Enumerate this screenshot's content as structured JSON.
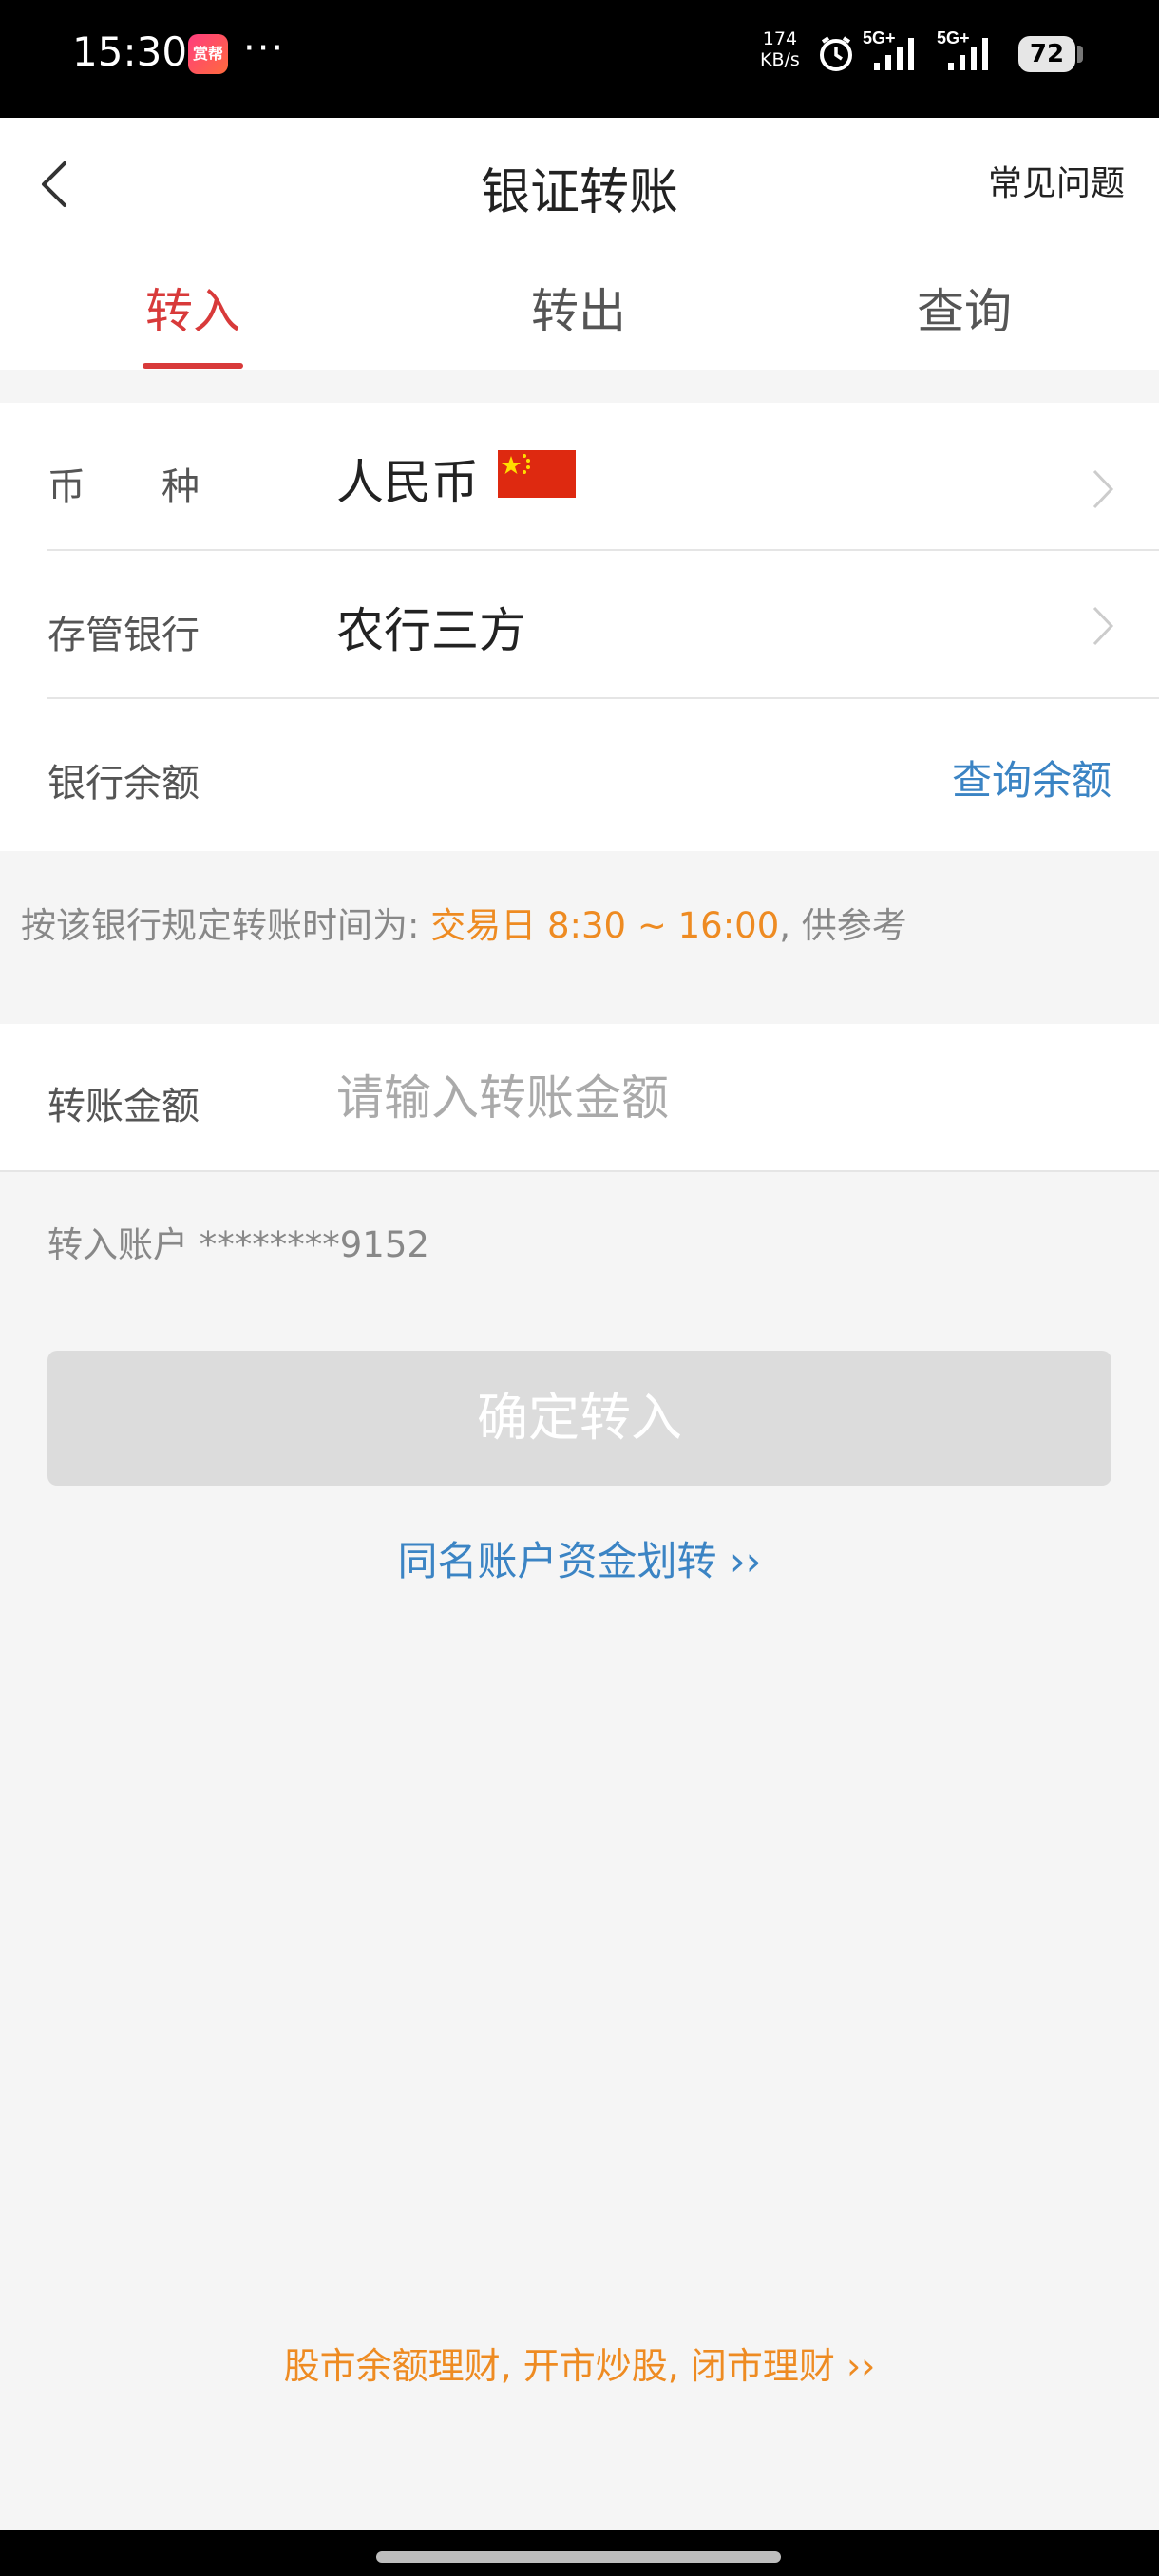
{
  "status_bar": {
    "time": "15:30",
    "app_icon_text": "赏帮",
    "more": "···",
    "speed_value": "174",
    "speed_unit": "KB/s",
    "signal1_label": "5G+",
    "signal2_label": "5G+",
    "battery": "72"
  },
  "header": {
    "title": "银证转账",
    "faq": "常见问题"
  },
  "tabs": [
    {
      "label": "转入",
      "active": true
    },
    {
      "label": "转出",
      "active": false
    },
    {
      "label": "查询",
      "active": false
    }
  ],
  "form": {
    "currency_label": "币　　种",
    "currency_value": "人民币",
    "bank_label": "存管银行",
    "bank_value": "农行三方",
    "balance_label": "银行余额",
    "balance_link": "查询余额"
  },
  "notice": {
    "prefix": "按该银行规定转账时间为: ",
    "highlight": "交易日 8:30 ~ 16:00",
    "suffix": ", 供参考"
  },
  "amount": {
    "label": "转账金额",
    "placeholder": "请输入转账金额",
    "value": ""
  },
  "account": {
    "text": "转入账户 ********9152"
  },
  "confirm_button": "确定转入",
  "same_name_link": "同名账户资金划转 ››",
  "promo_link": "股市余额理财, 开市炒股, 闭市理财 ››",
  "colors": {
    "accent": "#d83a3a",
    "link_blue": "#3b84c4",
    "highlight_orange": "#ee8b22"
  }
}
